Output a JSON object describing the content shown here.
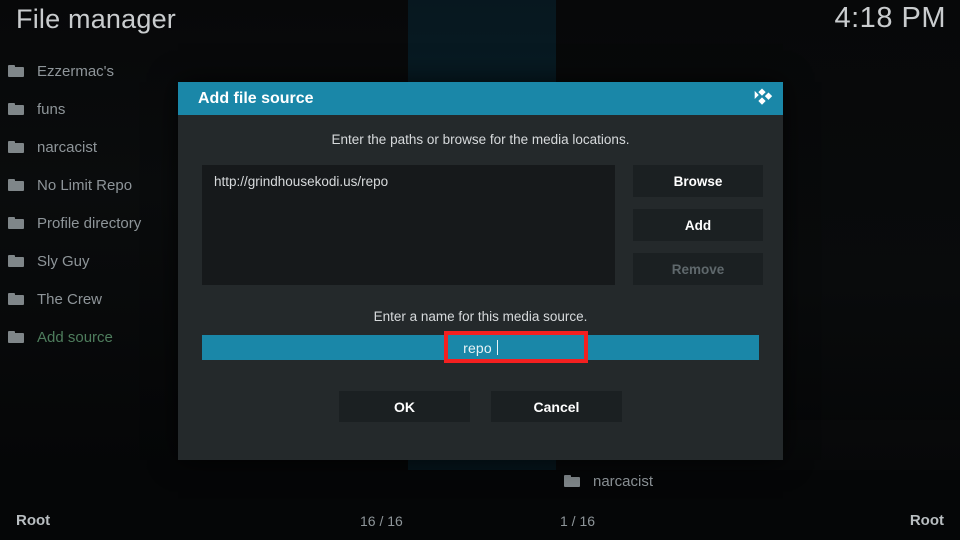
{
  "header": {
    "title": "File manager",
    "clock": "4:18 PM"
  },
  "colors": {
    "accent_teal": "#1a87a8",
    "annotation_red": "#f32020",
    "add_source_green": "#4e7d5d",
    "dialog_bg": "#24292b",
    "text_muted": "#8e9599"
  },
  "left_panel": {
    "items": [
      {
        "icon": "folder-icon",
        "label": "Ezzermac's",
        "accent": false
      },
      {
        "icon": "folder-icon",
        "label": "funs",
        "accent": false
      },
      {
        "icon": "folder-icon",
        "label": "narcacist",
        "accent": false
      },
      {
        "icon": "folder-icon",
        "label": "No Limit Repo",
        "accent": false
      },
      {
        "icon": "folder-icon",
        "label": "Profile directory",
        "accent": false
      },
      {
        "icon": "folder-icon",
        "label": "Sly Guy",
        "accent": false
      },
      {
        "icon": "folder-icon",
        "label": "The Crew",
        "accent": false
      },
      {
        "icon": "folder-icon",
        "label": "Add source",
        "accent": true
      }
    ],
    "status_path": "Root",
    "status_count": "16 / 16"
  },
  "right_panel": {
    "items": [
      {
        "icon": "folder-icon",
        "label": "narcacist"
      }
    ],
    "status_count": "1 / 16",
    "status_path": "Root"
  },
  "dialog": {
    "title": "Add file source",
    "logo": "kodi-logo-icon",
    "paths_hint": "Enter the paths or browse for the media locations.",
    "paths": [
      "http://grindhousekodi.us/repo"
    ],
    "side_buttons": [
      {
        "label": "Browse",
        "disabled": false
      },
      {
        "label": "Add",
        "disabled": false
      },
      {
        "label": "Remove",
        "disabled": true
      }
    ],
    "name_hint": "Enter a name for this media source.",
    "name_value": "repo",
    "actions": [
      {
        "label": "OK"
      },
      {
        "label": "Cancel"
      }
    ]
  }
}
